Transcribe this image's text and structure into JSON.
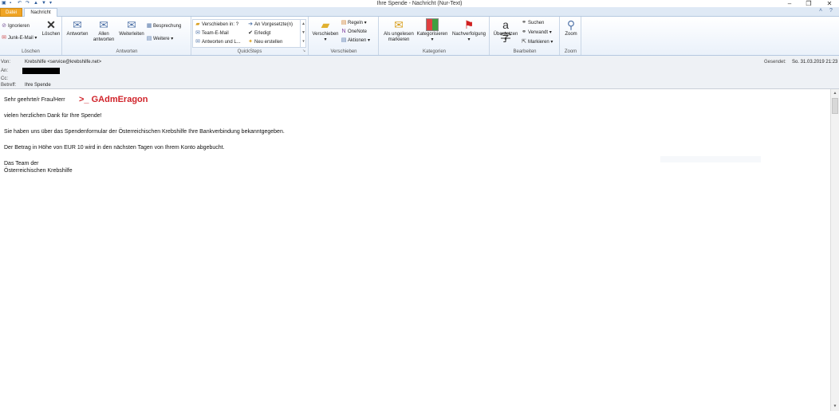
{
  "window": {
    "title": "Ihre Spende - Nachricht (Nur-Text)"
  },
  "tabs": [
    {
      "label": "Datei"
    },
    {
      "label": "Nachricht"
    }
  ],
  "ribbon": {
    "loeschen": {
      "group_label": "Löschen",
      "ignorieren": "Ignorieren",
      "junk": "Junk-E-Mail",
      "loeschen": "Löschen"
    },
    "antworten": {
      "group_label": "Antworten",
      "antworten": "Antworten",
      "allen_line1": "Allen",
      "allen_line2": "antworten",
      "weiterleiten": "Weiterleiten",
      "besprechung": "Besprechung",
      "weitere": "Weitere"
    },
    "quicksteps": {
      "group_label": "QuickSteps",
      "items": [
        "Verschieben in: ?",
        "An Vorgesetzte(n)",
        "Team-E-Mail",
        "Erledigt",
        "Antworten und L...",
        "Neu erstellen"
      ]
    },
    "verschieben": {
      "group_label": "Verschieben",
      "verschieben": "Verschieben",
      "regeln": "Regeln",
      "onenote": "OneNote",
      "aktionen": "Aktionen"
    },
    "kategorien": {
      "group_label": "Kategorien",
      "ungelesen_line1": "Als ungelesen",
      "ungelesen_line2": "markieren",
      "kategorisieren": "Kategorisieren",
      "nachverfolgung": "Nachverfolgung"
    },
    "bearbeiten": {
      "group_label": "Bearbeiten",
      "uebersetzen": "Übersetzen",
      "suchen": "Suchen",
      "verwandt": "Verwandt",
      "markieren": "Markieren"
    },
    "zoom": {
      "group_label": "Zoom",
      "zoom": "Zoom"
    }
  },
  "header": {
    "von_label": "Von:",
    "von_value": "Krebshilfe <service@krebshilfe.net>",
    "an_label": "An:",
    "cc_label": "Cc:",
    "betreff_label": "Betreff:",
    "betreff_value": "Ihre Spende",
    "gesendet_label": "Gesendet:",
    "gesendet_value": "So. 31.03.2019 21:23"
  },
  "message": {
    "greeting": "Sehr geehrte/r Frau/Herr",
    "watermark": ">_ GAdmEragon",
    "line1": "vielen herzlichen Dank für Ihre Spende!",
    "line2": "Sie haben uns über das Spendenformular der Österreichischen Krebshilfe Ihre Bankverbindung bekanntgegeben.",
    "line3": "Der Betrag in Höhe von EUR 10 wird in den nächsten Tagen von Ihrem Konto abgebucht.",
    "sign1": "Das Team der",
    "sign2": "Österreichischen Krebshilfe"
  },
  "colors": {
    "datei_tab": "#f0a424",
    "watermark": "#d0232a",
    "ribbon_bg": "#eaf1fa"
  }
}
